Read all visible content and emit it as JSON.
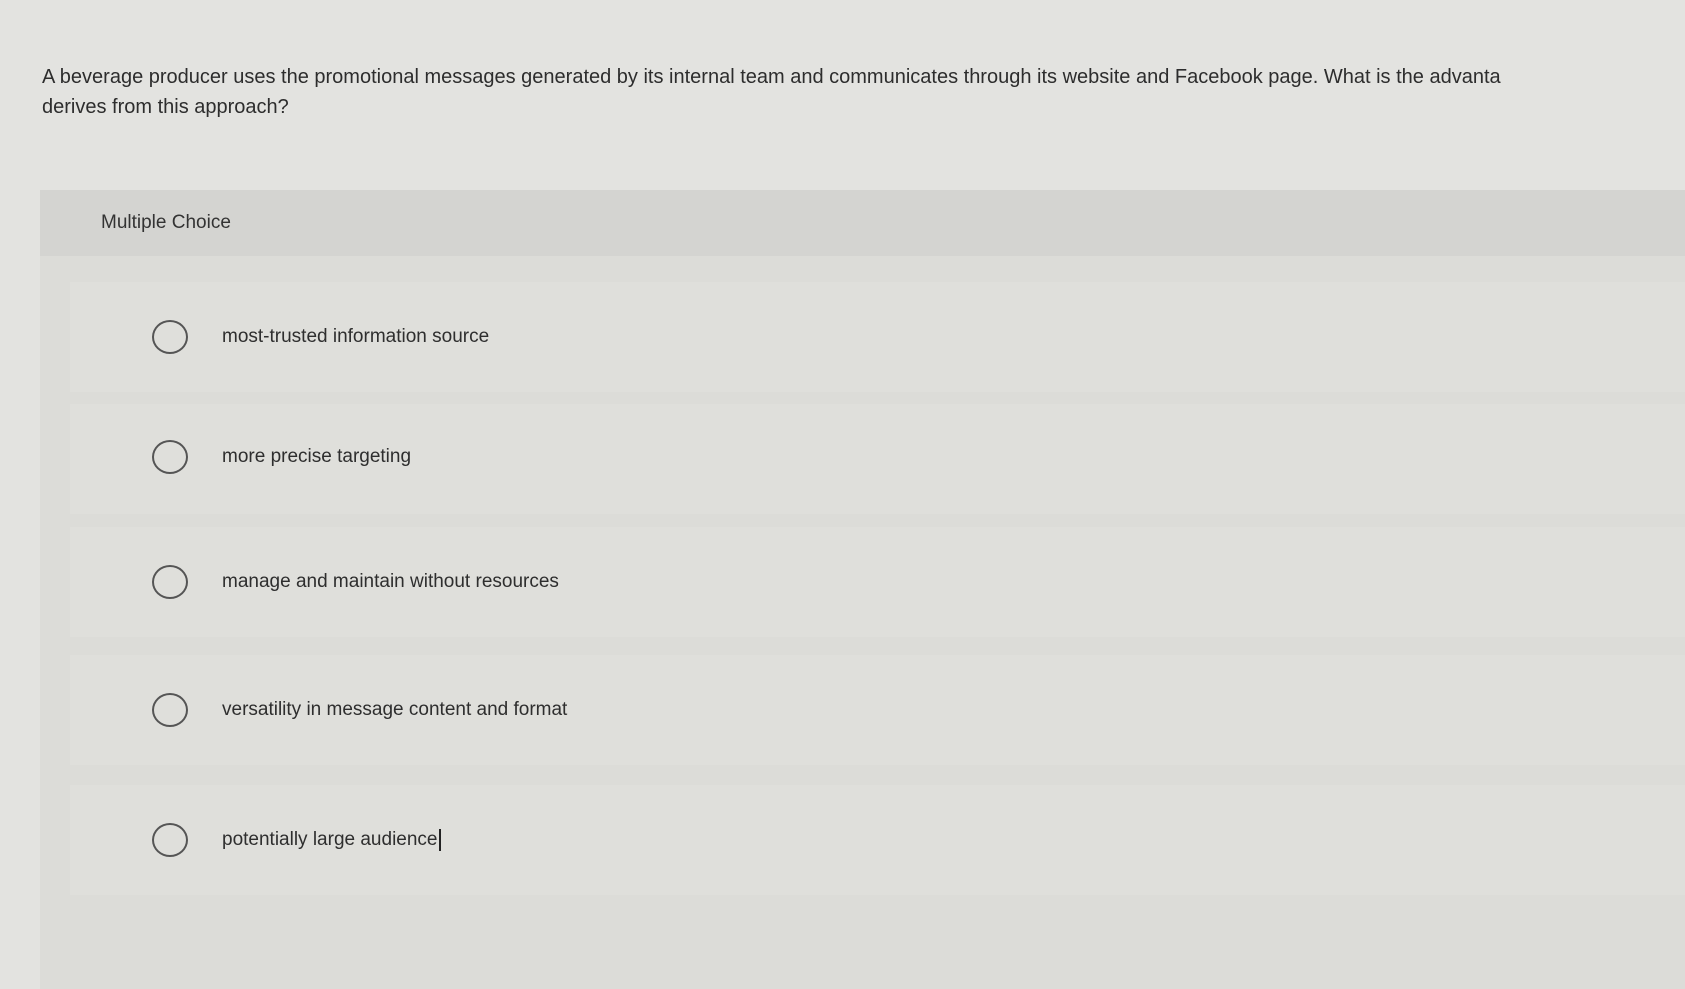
{
  "question": {
    "line1": "A beverage producer uses the promotional messages generated by its internal team and communicates through its website and Facebook page. What is the advanta",
    "line2": "derives from this approach?"
  },
  "multiple_choice": {
    "header": "Multiple Choice",
    "options": [
      {
        "label": "most-trusted information source"
      },
      {
        "label": "more precise targeting"
      },
      {
        "label": "manage and maintain without resources"
      },
      {
        "label": "versatility in message content and format"
      },
      {
        "label": "potentially large audience"
      }
    ]
  }
}
